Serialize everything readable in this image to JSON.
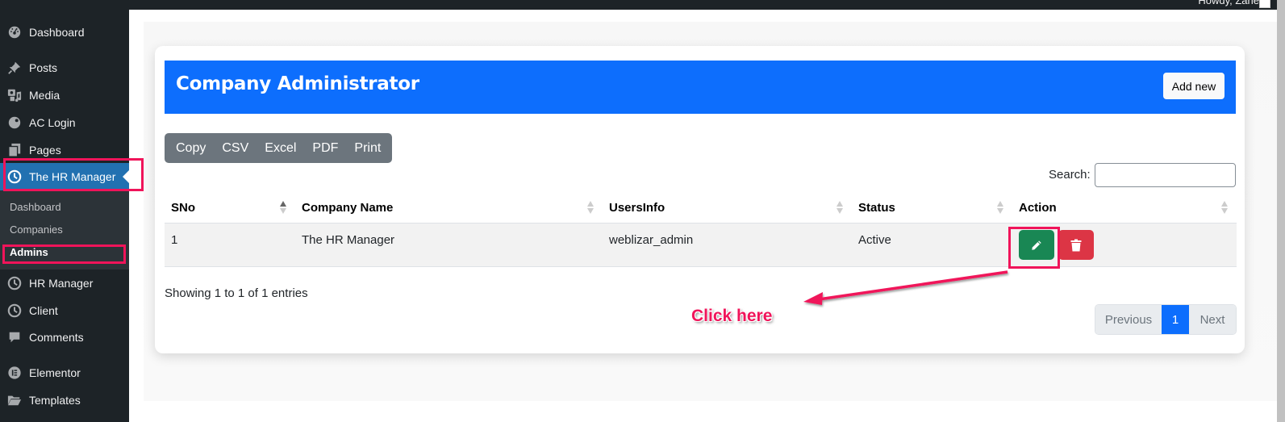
{
  "adminbar": {
    "greeting": "Howdy, Zane"
  },
  "sidebar": {
    "items": [
      {
        "label": "Dashboard",
        "icon": "dashboard-icon"
      },
      {
        "label": "Posts",
        "icon": "pin-icon"
      },
      {
        "label": "Media",
        "icon": "media-icon"
      },
      {
        "label": "AC Login",
        "icon": "palette-icon"
      },
      {
        "label": "Pages",
        "icon": "pages-icon"
      },
      {
        "label": "The HR Manager",
        "icon": "clock-icon",
        "active": true
      },
      {
        "label": "HR Manager",
        "icon": "clock-icon"
      },
      {
        "label": "Client",
        "icon": "clock-icon"
      },
      {
        "label": "Comments",
        "icon": "comment-icon"
      },
      {
        "label": "Elementor",
        "icon": "elementor-icon"
      },
      {
        "label": "Templates",
        "icon": "folder-icon"
      }
    ],
    "submenu": [
      {
        "label": "Dashboard"
      },
      {
        "label": "Companies"
      },
      {
        "label": "Admins",
        "current": true
      }
    ]
  },
  "card": {
    "title": "Company Administrator",
    "add_new_label": "Add new",
    "header_color": "#0d6efd"
  },
  "export_buttons": [
    "Copy",
    "CSV",
    "Excel",
    "PDF",
    "Print"
  ],
  "search": {
    "label": "Search:",
    "value": "",
    "placeholder": ""
  },
  "table": {
    "columns": [
      "SNo",
      "Company Name",
      "UsersInfo",
      "Status",
      "Action"
    ],
    "sorted_column": "SNo",
    "sort_direction": "asc",
    "rows": [
      {
        "sno": "1",
        "company_name": "The HR Manager",
        "users_info": "weblizar_admin",
        "status": "Active",
        "actions": [
          "edit-icon",
          "trash-icon"
        ]
      }
    ]
  },
  "info_text": "Showing 1 to 1 of 1 entries",
  "pagination": {
    "previous": "Previous",
    "current": "1",
    "next": "Next"
  },
  "annotation": {
    "text": "Click here",
    "color": "#f0145a"
  }
}
